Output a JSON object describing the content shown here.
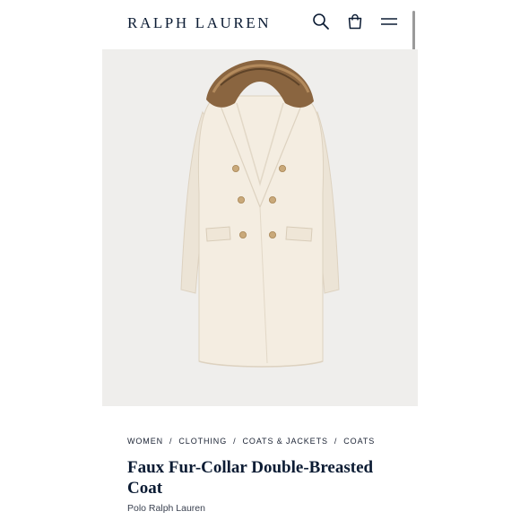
{
  "header": {
    "logo": "RALPH LAUREN",
    "icons": [
      "search-icon",
      "shopping-bag-icon",
      "menu-icon"
    ]
  },
  "breadcrumb": [
    "WOMEN",
    "CLOTHING",
    "COATS & JACKETS",
    "COATS"
  ],
  "product": {
    "title": "Faux Fur-Collar Double-Breasted Coat",
    "brand": "Polo Ralph Lauren",
    "image": "cream-double-breasted-coat-with-faux-fur-collar"
  },
  "colors": {
    "text": "#0b1b33",
    "image_bg": "#efeeec",
    "coat": "#f3ece0",
    "fur": "#8a6540",
    "buttons": "#c9a97a"
  }
}
